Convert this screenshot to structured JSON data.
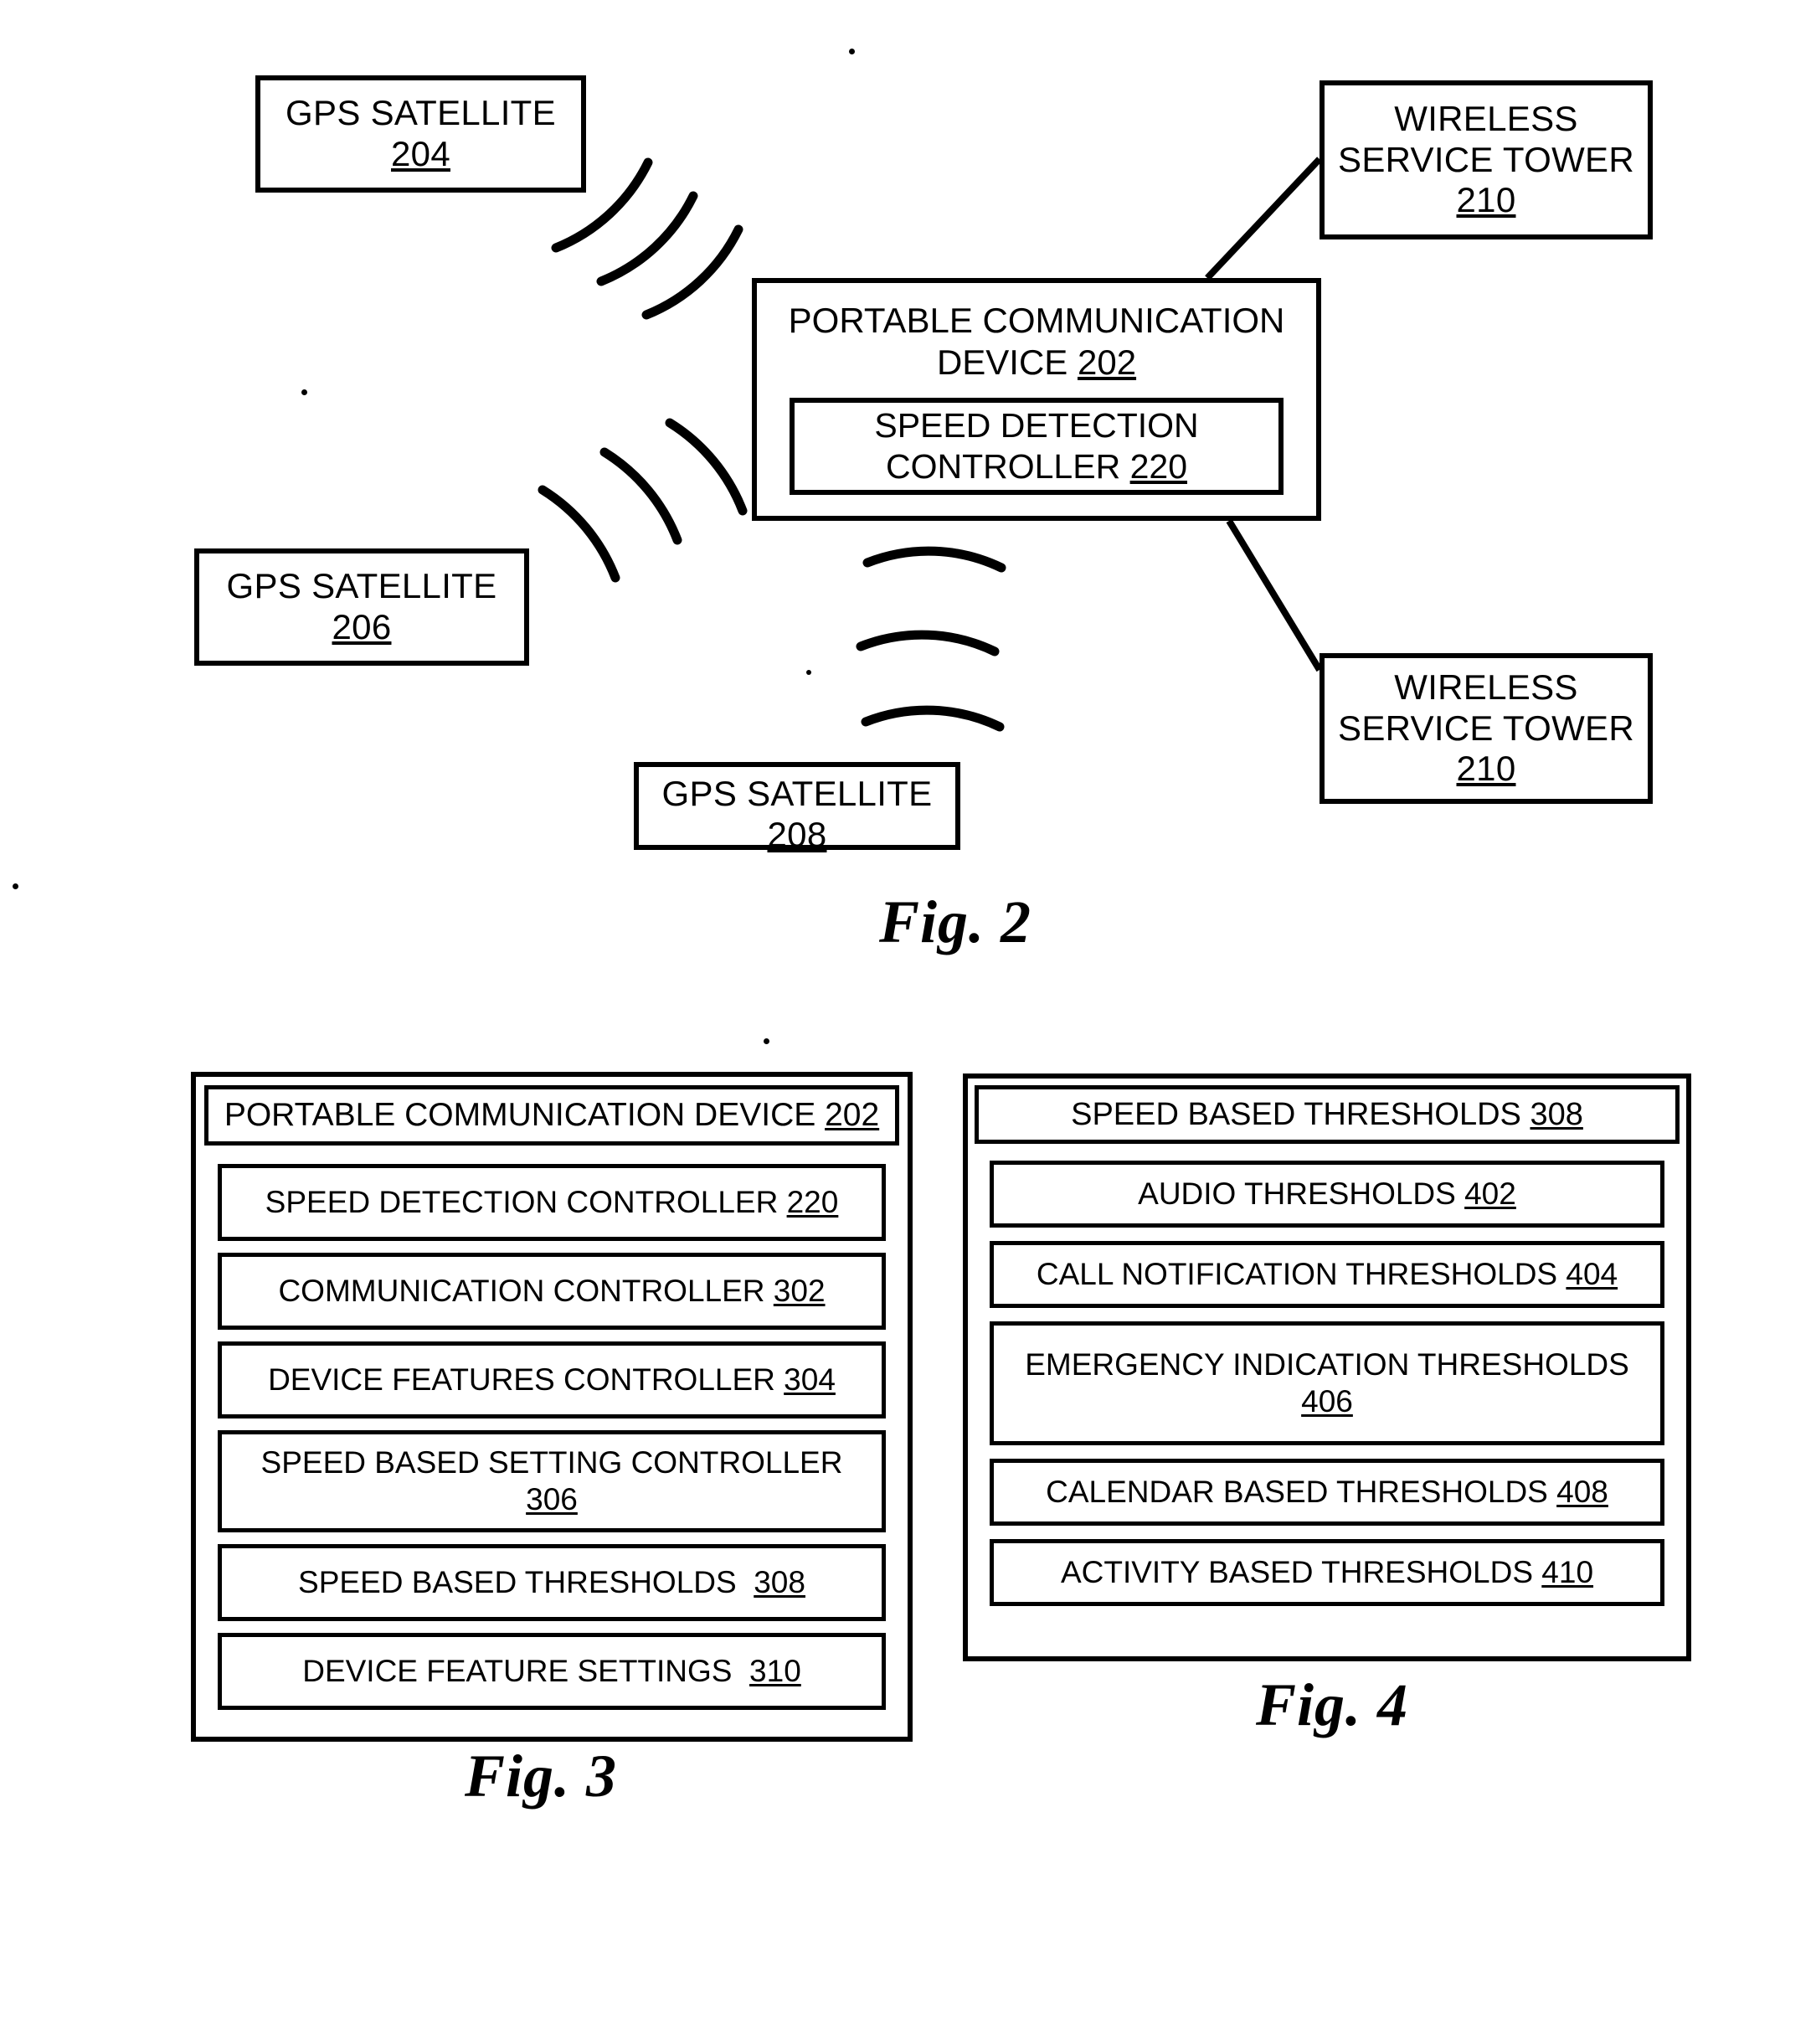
{
  "figures": {
    "fig2": {
      "caption": "Fig. 2",
      "satellite_204": {
        "line1": "GPS SATELLITE",
        "ref": "204"
      },
      "satellite_206": {
        "line1": "GPS SATELLITE",
        "ref": "206"
      },
      "satellite_208": {
        "line1": "GPS SATELLITE",
        "ref": "208"
      },
      "tower_top": {
        "line1": "WIRELESS",
        "line2": "SERVICE TOWER",
        "ref": "210"
      },
      "tower_bottom": {
        "line1": "WIRELESS",
        "line2": "SERVICE TOWER",
        "ref": "210"
      },
      "device": {
        "line1": "PORTABLE COMMUNICATION",
        "line2": "DEVICE",
        "ref": "202",
        "inner": {
          "line1": "SPEED DETECTION",
          "line2": "CONTROLLER",
          "ref": "220"
        }
      }
    },
    "fig3": {
      "caption": "Fig. 3",
      "header": {
        "label": "PORTABLE COMMUNICATION DEVICE",
        "ref": "202"
      },
      "items": [
        {
          "label": "SPEED DETECTION CONTROLLER",
          "ref": "220",
          "lines": 1
        },
        {
          "label": "COMMUNICATION CONTROLLER",
          "ref": "302",
          "lines": 1
        },
        {
          "label": "DEVICE FEATURES CONTROLLER",
          "ref": "304",
          "lines": 1
        },
        {
          "label": "SPEED BASED SETTING CONTROLLER",
          "ref": "306",
          "lines": 2
        },
        {
          "label": "SPEED BASED THRESHOLDS ",
          "ref": "308",
          "lines": 1
        },
        {
          "label": "DEVICE FEATURE SETTINGS ",
          "ref": "310",
          "lines": 1
        }
      ]
    },
    "fig4": {
      "caption": "Fig. 4",
      "header": {
        "label": "SPEED BASED THRESHOLDS",
        "ref": "308"
      },
      "items": [
        {
          "label": "AUDIO THRESHOLDS",
          "ref": "402",
          "lines": 1
        },
        {
          "label": "CALL NOTIFICATION THRESHOLDS",
          "ref": "404",
          "lines": 1
        },
        {
          "label": "EMERGENCY INDICATION THRESHOLDS",
          "ref": "406",
          "lines": 2
        },
        {
          "label": "CALENDAR BASED THRESHOLDS",
          "ref": "408",
          "lines": 1
        },
        {
          "label": "ACTIVITY BASED THRESHOLDS",
          "ref": "410",
          "lines": 1
        }
      ]
    }
  },
  "colors": {
    "ink": "#000000",
    "paper": "#ffffff"
  }
}
